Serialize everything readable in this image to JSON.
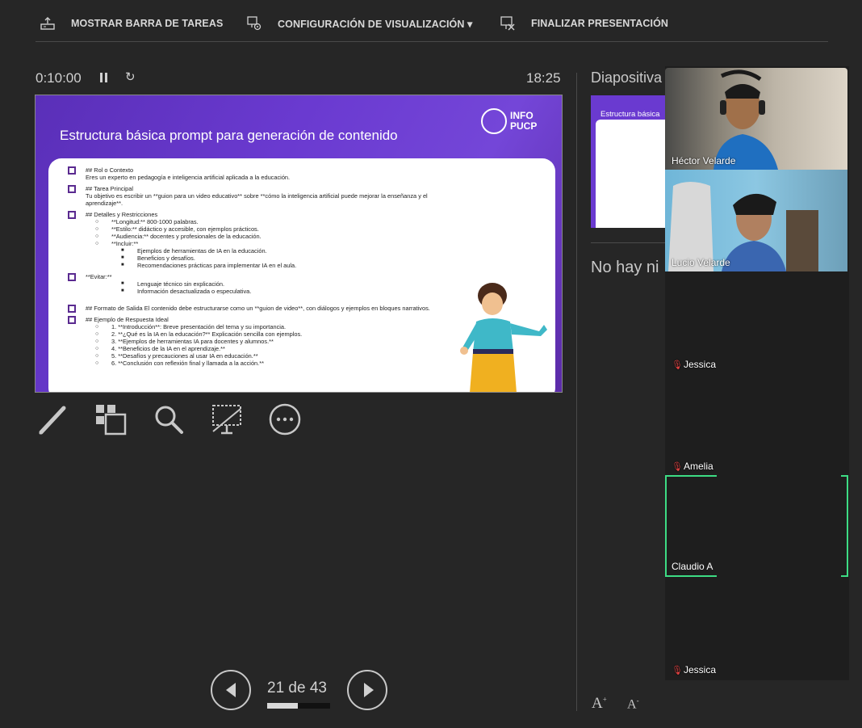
{
  "toolbar": {
    "show_taskbar": "MOSTRAR BARRA DE TAREAS",
    "display_settings": "CONFIGURACIÓN DE VISUALIZACIÓN ▾",
    "end_show": "FINALIZAR PRESENTACIÓN"
  },
  "timer": {
    "elapsed": "0:10:00",
    "clock": "18:25"
  },
  "slide": {
    "title": "Estructura básica prompt para generación de contenido",
    "logo_text": [
      "INFO",
      "PUCP"
    ],
    "sections": {
      "rol_h": "## Rol o Contexto",
      "rol_t": "Eres un experto en pedagogía e inteligencia artificial aplicada a la educación.",
      "tarea_h": "## Tarea Principal",
      "tarea_t": "Tu objetivo es escribir un **guion para un video educativo** sobre **cómo la inteligencia artificial puede mejorar la enseñanza y el aprendizaje**.",
      "det_h": "## Detalles y Restricciones",
      "det_1": "**Longitud:** 800-1000 palabras.",
      "det_2": "**Estilo:** didáctico y accesible, con ejemplos prácticos.",
      "det_3": "**Audiencia:** docentes y profesionales de la educación.",
      "det_4": "**Incluir:**",
      "inc_1": "Ejemplos de herramientas de IA en la educación.",
      "inc_2": "Beneficios y desafíos.",
      "inc_3": "Recomendaciones prácticas para implementar IA en el aula.",
      "evitar_h": "**Evitar:**",
      "ev_1": "Lenguaje técnico sin explicación.",
      "ev_2": "Información desactualizada o especulativa.",
      "formato": "## Formato de Salida El contenido debe estructurarse como un **guion de video**, con diálogos y ejemplos en bloques narrativos.",
      "ejemplo_h": "## Ejemplo de Respuesta Ideal",
      "ej_1": "1. **Introducción**: Breve presentación del tema y su importancia.",
      "ej_2": "2. **¿Qué es la IA en la educación?** Explicación sencilla con ejemplos.",
      "ej_3": "3. **Ejemplos de herramientas IA para docentes y alumnos.**",
      "ej_4": "4. **Beneficios de la IA en el aprendizaje.**",
      "ej_5": "5. **Desafíos y precauciones al usar IA en educación.**",
      "ej_6": "6. **Conclusión con reflexión final y llamada a la acción.**"
    }
  },
  "tools": [
    "pen-icon",
    "slides-grid-icon",
    "zoom-icon",
    "black-screen-icon",
    "more-icon"
  ],
  "navigation": {
    "page": "21 de 43",
    "progress": 0.49
  },
  "right": {
    "next_label": "Diapositiva",
    "next_thumb_title": "Estructura básica",
    "notes": "No hay ni"
  },
  "participants": [
    {
      "name": "Héctor Velarde",
      "muted": false
    },
    {
      "name": "Lucio Velarde",
      "muted": false
    },
    {
      "name": "Jessica",
      "muted": true
    },
    {
      "name": "Amelia",
      "muted": true
    },
    {
      "name": "Claudio A",
      "muted": false,
      "speaking": true
    },
    {
      "name": "Jessica",
      "muted": true
    }
  ],
  "colors": {
    "background": "#262626",
    "slide_purple": "#6a3ad0",
    "speaking": "#3ddc84",
    "mute": "#e04040"
  }
}
